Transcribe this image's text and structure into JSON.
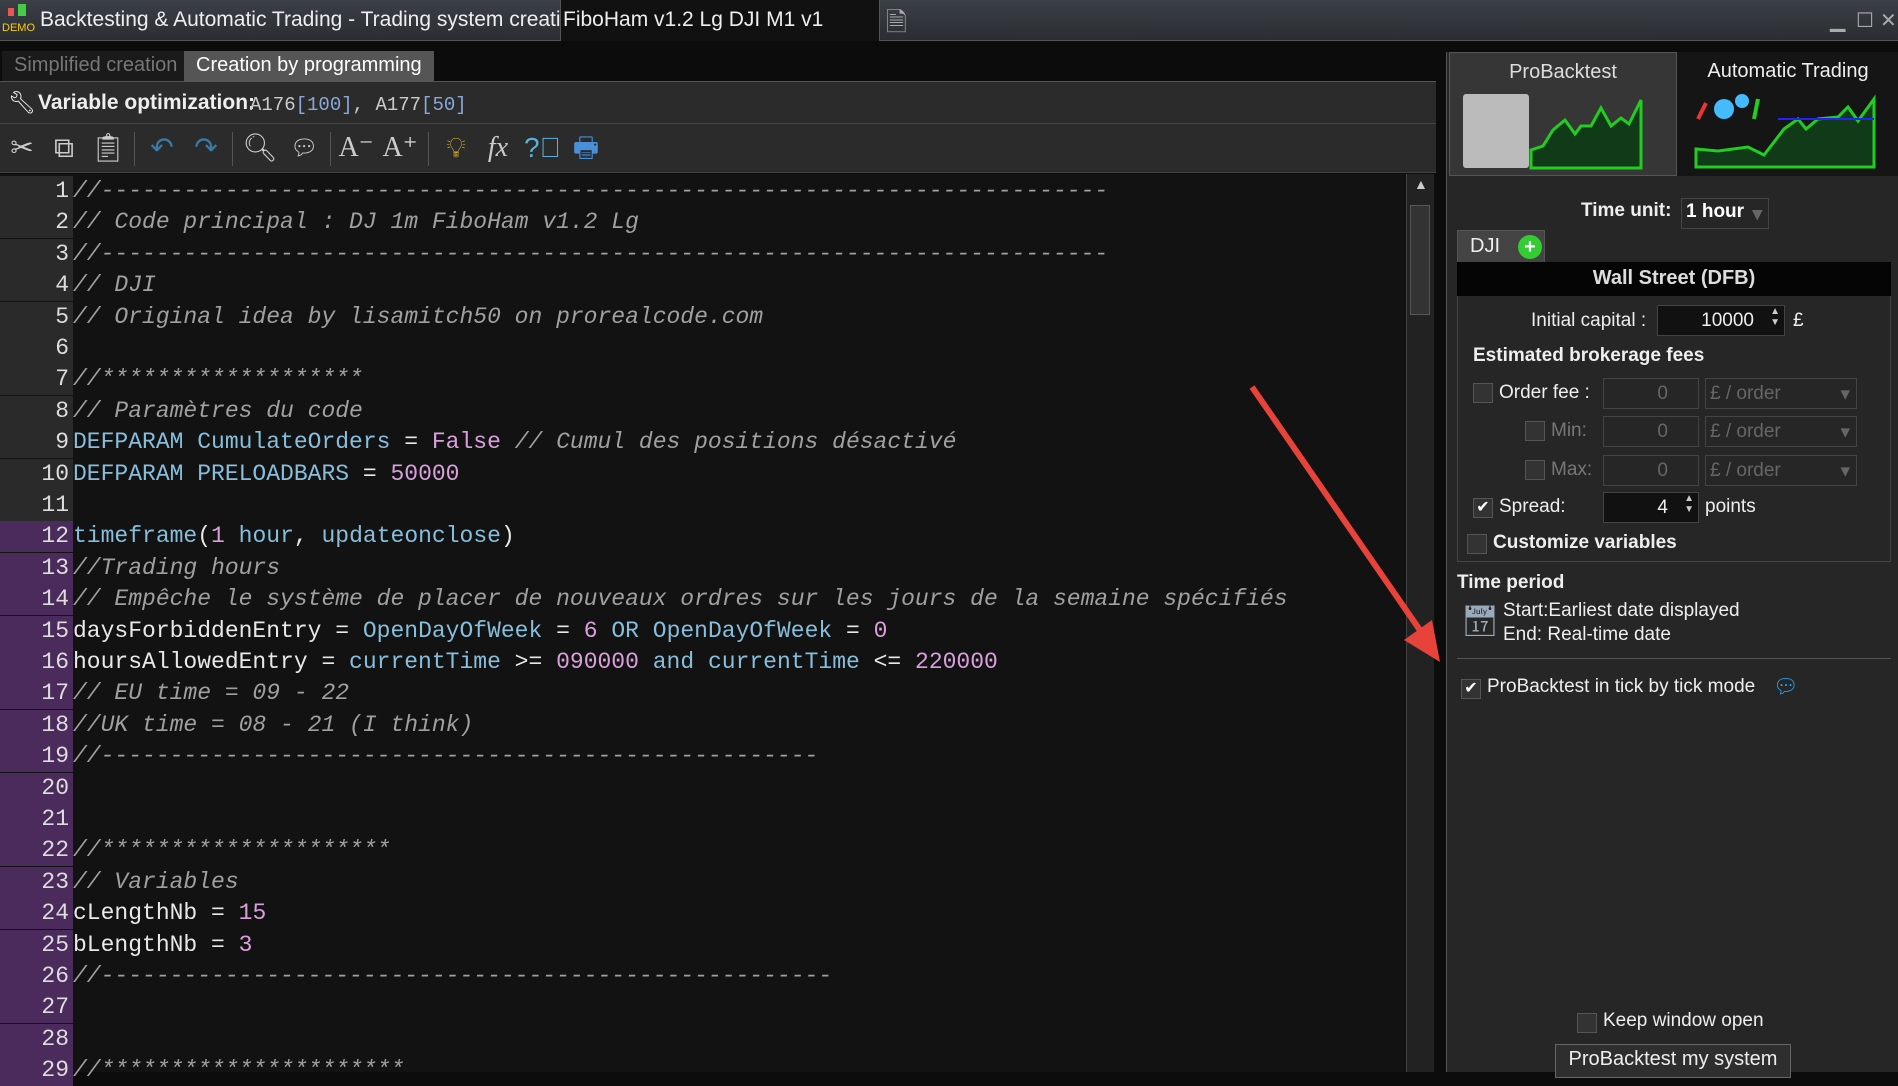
{
  "titlebar": {
    "badge": "DEMO",
    "app_title": "Backtesting & Automatic Trading - Trading system creation",
    "document": "FiboHam v1.2 Lg DJI M1 v1"
  },
  "tabs": [
    {
      "label": "Simplified creation"
    },
    {
      "label": "Creation by programming"
    }
  ],
  "optimization": {
    "label": "Variable optimization:",
    "v1": "A176",
    "r1": "[100]",
    "sep": ", ",
    "v2": "A177",
    "r2": "[50]"
  },
  "toolbar": [
    "cut",
    "copy",
    "paste",
    "undo",
    "redo",
    "search",
    "comment",
    "decrease-font",
    "increase-font",
    "idea",
    "function",
    "help",
    "print"
  ],
  "code": [
    [
      [
        "c",
        "//-------------------------------------------------------------------------"
      ]
    ],
    [
      [
        "c",
        "// Code principal : DJ 1m FiboHam v1.2 Lg"
      ]
    ],
    [
      [
        "c",
        "//-------------------------------------------------------------------------"
      ]
    ],
    [
      [
        "c",
        "// DJI"
      ]
    ],
    [
      [
        "c",
        "// Original idea by lisamitch50 on prorealcode.com"
      ]
    ],
    [],
    [
      [
        "c",
        "//*******************"
      ]
    ],
    [
      [
        "c",
        "// Paramètres du code"
      ]
    ],
    [
      [
        "k",
        "DEFPARAM CumulateOrders"
      ],
      [
        "x",
        " = "
      ],
      [
        "n",
        "False"
      ],
      [
        "c",
        " // Cumul des positions désactivé"
      ]
    ],
    [
      [
        "k",
        "DEFPARAM PRELOADBARS"
      ],
      [
        "x",
        " = "
      ],
      [
        "n",
        "50000"
      ]
    ],
    [],
    [
      [
        "k",
        "timeframe"
      ],
      [
        "x",
        "("
      ],
      [
        "n",
        "1"
      ],
      [
        "x",
        " "
      ],
      [
        "k",
        "hour"
      ],
      [
        "x",
        ", "
      ],
      [
        "k",
        "updateonclose"
      ],
      [
        "x",
        ")"
      ]
    ],
    [
      [
        "c",
        "//Trading hours"
      ]
    ],
    [
      [
        "c",
        "// Empêche le système de placer de nouveaux ordres sur les jours de la semaine spécifiés"
      ]
    ],
    [
      [
        "x",
        "daysForbiddenEntry = "
      ],
      [
        "k",
        "OpenDayOfWeek"
      ],
      [
        "x",
        " = "
      ],
      [
        "n",
        "6"
      ],
      [
        "x",
        " "
      ],
      [
        "k",
        "OR"
      ],
      [
        "x",
        " "
      ],
      [
        "k",
        "OpenDayOfWeek"
      ],
      [
        "x",
        " = "
      ],
      [
        "n",
        "0"
      ]
    ],
    [
      [
        "x",
        "hoursAllowedEntry = "
      ],
      [
        "k",
        "currentTime"
      ],
      [
        "x",
        " >= "
      ],
      [
        "n",
        "090000"
      ],
      [
        "x",
        " "
      ],
      [
        "k",
        "and"
      ],
      [
        "x",
        " "
      ],
      [
        "k",
        "currentTime"
      ],
      [
        "x",
        " <= "
      ],
      [
        "n",
        "220000"
      ]
    ],
    [
      [
        "c",
        "// EU time = 09 - 22"
      ]
    ],
    [
      [
        "c",
        "//UK time = 08 - 21 (I think)"
      ]
    ],
    [
      [
        "c",
        "//----------------------------------------------------"
      ]
    ],
    [],
    [],
    [
      [
        "c",
        "//*********************"
      ]
    ],
    [
      [
        "c",
        "// Variables"
      ]
    ],
    [
      [
        "x",
        "cLengthNb = "
      ],
      [
        "n",
        "15"
      ]
    ],
    [
      [
        "x",
        "bLengthNb = "
      ],
      [
        "n",
        "3"
      ]
    ],
    [
      [
        "c",
        "//-----------------------------------------------------"
      ]
    ],
    [],
    [],
    [
      [
        "c",
        "//**********************"
      ]
    ]
  ],
  "panel": {
    "tab_probacktest": "ProBacktest",
    "tab_auto": "Automatic Trading",
    "time_unit_label": "Time unit:",
    "time_unit": "1 hour",
    "instrument_tab": "DJI",
    "instrument_name": "Wall Street (DFB)",
    "capital_label": "Initial capital :",
    "capital": "10000",
    "currency": "£",
    "fees_title": "Estimated brokerage fees",
    "order_fee_label": "Order fee :",
    "min_label": "Min:",
    "max_label": "Max:",
    "fee_value": "0",
    "fee_unit": "£ / order",
    "spread_label": "Spread:",
    "spread": "4",
    "spread_unit": "points",
    "customize": "Customize variables",
    "period_title": "Time period",
    "start": "Start:Earliest date displayed",
    "end": "End:  Real-time date",
    "tick_mode": "ProBacktest in tick by tick mode",
    "tick_mode_checked": true,
    "spread_checked": true,
    "keep_open": "Keep window open",
    "run_button": "ProBacktest my system"
  },
  "colors": {
    "keyword": "#86bedc",
    "number": "#d9a0dc",
    "comment": "#a0a0a0",
    "gutter_highlight": "#4a2b5c",
    "arrow": "#e8433a"
  }
}
